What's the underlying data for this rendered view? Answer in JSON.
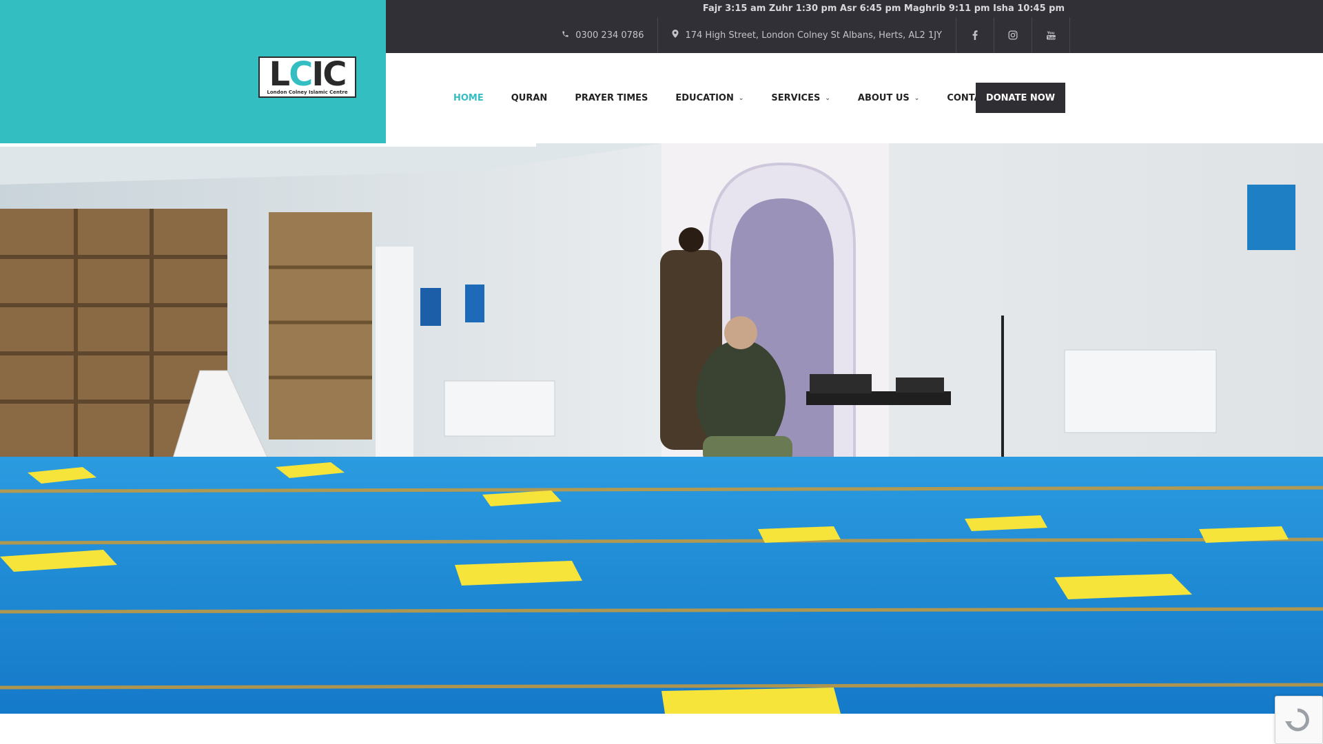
{
  "logo": {
    "letters_1": "L",
    "letters_accent": "C",
    "letters_2": "IC",
    "subtitle": "London Colney Islamic Centre"
  },
  "topbar": {
    "prayer_times": "Fajr 3:15 am Zuhr 1:30 pm Asr 6:45 pm Maghrib 9:11 pm Isha 10:45 pm",
    "phone": "0300 234 0786",
    "address": "174 High Street, London Colney  St Albans, Herts, AL2 1JY",
    "social": [
      "facebook-icon",
      "instagram-icon",
      "youtube-icon"
    ]
  },
  "nav": {
    "items": [
      {
        "label": "HOME",
        "active": true,
        "dropdown": false
      },
      {
        "label": "QURAN",
        "active": false,
        "dropdown": false
      },
      {
        "label": "PRAYER TIMES",
        "active": false,
        "dropdown": false
      },
      {
        "label": "EDUCATION",
        "active": false,
        "dropdown": true
      },
      {
        "label": "SERVICES",
        "active": false,
        "dropdown": true
      },
      {
        "label": "ABOUT US",
        "active": false,
        "dropdown": true
      },
      {
        "label": "CONTACT US",
        "active": false,
        "dropdown": true
      }
    ],
    "donate_label": "DONATE NOW"
  },
  "colors": {
    "accent": "#33bfc2",
    "topbar_bg": "#303036",
    "donate_bg": "#2e2e33",
    "carpet": "#1f8ad8"
  }
}
